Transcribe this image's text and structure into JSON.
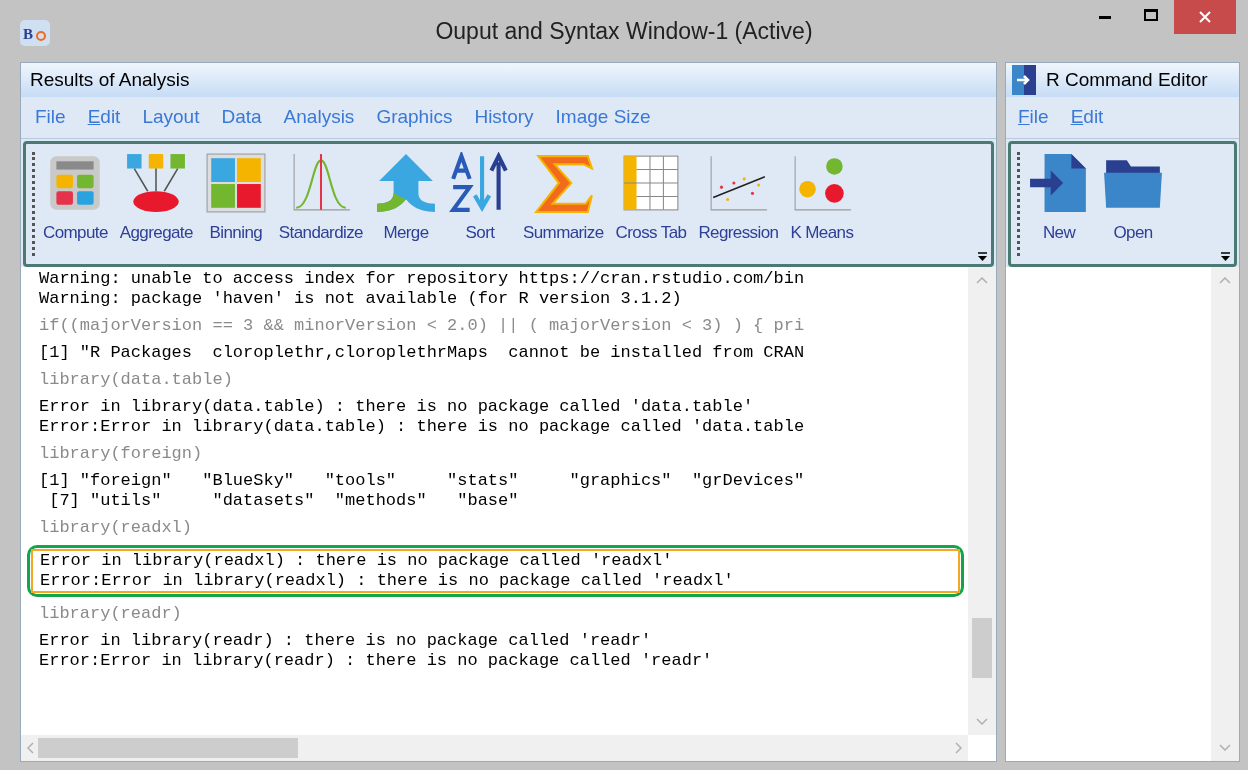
{
  "window": {
    "title": "Ouput and Syntax Window-1 (Active)",
    "logo": "B"
  },
  "results": {
    "title": "Results of Analysis",
    "menu": [
      {
        "label": "File",
        "underlined": false
      },
      {
        "label": "Edit",
        "underlined": true
      },
      {
        "label": "Layout",
        "underlined": false
      },
      {
        "label": "Data",
        "underlined": false
      },
      {
        "label": "Analysis",
        "underlined": false
      },
      {
        "label": "Graphics",
        "underlined": false
      },
      {
        "label": "History",
        "underlined": false
      },
      {
        "label": "Image Size",
        "underlined": false
      }
    ],
    "toolbar": [
      "Compute",
      "Aggregate",
      "Binning",
      "Standardize",
      "Merge",
      "Sort",
      "Summarize",
      "Cross Tab",
      "Regression",
      "K Means"
    ],
    "output": [
      {
        "kind": "output",
        "highlighted": false,
        "lines": [
          "Warning: unable to access index for repository https://cran.rstudio.com/bin",
          "Warning: package 'haven' is not available (for R version 3.1.2)"
        ]
      },
      {
        "kind": "command",
        "highlighted": false,
        "lines": [
          "if((majorVersion == 3 && minorVersion < 2.0) || ( majorVersion < 3) ) { pri"
        ]
      },
      {
        "kind": "output",
        "highlighted": false,
        "lines": [
          "[1] \"R Packages  cloroplethr,cloroplethrMaps  cannot be installed from CRAN"
        ]
      },
      {
        "kind": "command",
        "highlighted": false,
        "lines": [
          "library(data.table)"
        ]
      },
      {
        "kind": "output",
        "highlighted": false,
        "lines": [
          "Error in library(data.table) : there is no package called 'data.table'",
          "Error:Error in library(data.table) : there is no package called 'data.table"
        ]
      },
      {
        "kind": "command",
        "highlighted": false,
        "lines": [
          "library(foreign)"
        ]
      },
      {
        "kind": "output",
        "highlighted": false,
        "lines": [
          "[1] \"foreign\"   \"BlueSky\"   \"tools\"     \"stats\"     \"graphics\"  \"grDevices\"",
          " [7] \"utils\"     \"datasets\"  \"methods\"   \"base\""
        ]
      },
      {
        "kind": "command",
        "highlighted": false,
        "lines": [
          "library(readxl)"
        ]
      },
      {
        "kind": "output",
        "highlighted": true,
        "lines": [
          "Error in library(readxl) : there is no package called 'readxl'",
          "Error:Error in library(readxl) : there is no package called 'readxl'"
        ]
      },
      {
        "kind": "command",
        "highlighted": false,
        "lines": [
          "library(readr)"
        ]
      },
      {
        "kind": "output",
        "highlighted": false,
        "lines": [
          "Error in library(readr) : there is no package called 'readr'",
          "Error:Error in library(readr) : there is no package called 'readr'"
        ]
      }
    ]
  },
  "editor": {
    "title": "R Command Editor",
    "menu": [
      {
        "label": "File",
        "underlined": true
      },
      {
        "label": "Edit",
        "underlined": true
      }
    ],
    "toolbar": [
      "New",
      "Open"
    ]
  }
}
